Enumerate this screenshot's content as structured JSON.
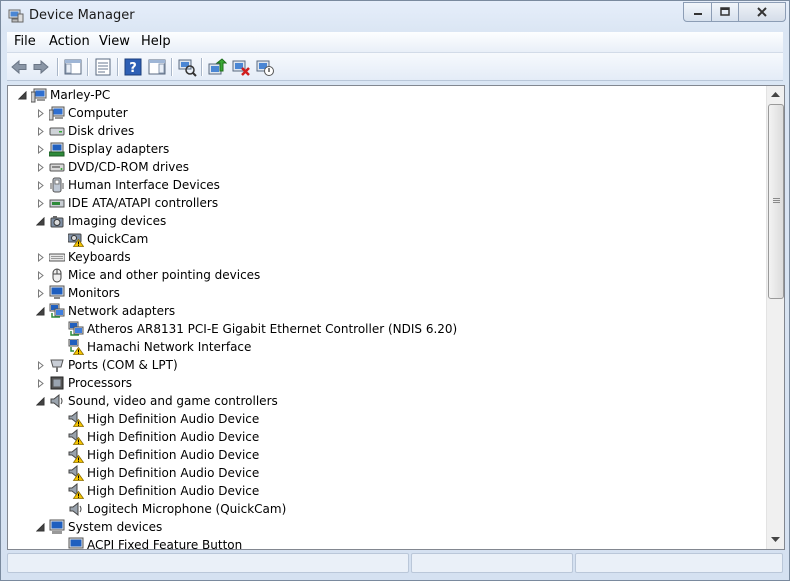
{
  "window": {
    "title": "Device Manager"
  },
  "menu": {
    "items": [
      "File",
      "Action",
      "View",
      "Help"
    ]
  },
  "toolbar": {
    "buttons": [
      "back",
      "forward",
      "show-hide-console-tree",
      "properties",
      "help",
      "show-action-pane",
      "scan-hardware-changes",
      "update-driver",
      "uninstall",
      "enable-disable"
    ]
  },
  "tree": {
    "rows": [
      {
        "label": "Marley-PC",
        "level": 0,
        "expander": "expanded",
        "icon": "computer-icon"
      },
      {
        "label": "Computer",
        "level": 1,
        "expander": "collapsed",
        "icon": "computer-icon"
      },
      {
        "label": "Disk drives",
        "level": 1,
        "expander": "collapsed",
        "icon": "disk-drive-icon"
      },
      {
        "label": "Display adapters",
        "level": 1,
        "expander": "collapsed",
        "icon": "display-adapter-icon"
      },
      {
        "label": "DVD/CD-ROM drives",
        "level": 1,
        "expander": "collapsed",
        "icon": "dvd-drive-icon"
      },
      {
        "label": "Human Interface Devices",
        "level": 1,
        "expander": "collapsed",
        "icon": "hid-icon"
      },
      {
        "label": "IDE ATA/ATAPI controllers",
        "level": 1,
        "expander": "collapsed",
        "icon": "ide-controller-icon"
      },
      {
        "label": "Imaging devices",
        "level": 1,
        "expander": "expanded",
        "icon": "camera-icon"
      },
      {
        "label": "QuickCam",
        "level": 2,
        "expander": "none",
        "icon": "camera-warning-icon"
      },
      {
        "label": "Keyboards",
        "level": 1,
        "expander": "collapsed",
        "icon": "keyboard-icon"
      },
      {
        "label": "Mice and other pointing devices",
        "level": 1,
        "expander": "collapsed",
        "icon": "mouse-icon"
      },
      {
        "label": "Monitors",
        "level": 1,
        "expander": "collapsed",
        "icon": "monitor-icon"
      },
      {
        "label": "Network adapters",
        "level": 1,
        "expander": "expanded",
        "icon": "network-icon"
      },
      {
        "label": "Atheros AR8131 PCI-E Gigabit Ethernet Controller (NDIS 6.20)",
        "level": 2,
        "expander": "none",
        "icon": "network-icon"
      },
      {
        "label": "Hamachi Network Interface",
        "level": 2,
        "expander": "none",
        "icon": "network-warning-icon"
      },
      {
        "label": "Ports (COM & LPT)",
        "level": 1,
        "expander": "collapsed",
        "icon": "port-icon"
      },
      {
        "label": "Processors",
        "level": 1,
        "expander": "collapsed",
        "icon": "processor-icon"
      },
      {
        "label": "Sound, video and game controllers",
        "level": 1,
        "expander": "expanded",
        "icon": "speaker-icon"
      },
      {
        "label": "High Definition Audio Device",
        "level": 2,
        "expander": "none",
        "icon": "speaker-warning-icon"
      },
      {
        "label": "High Definition Audio Device",
        "level": 2,
        "expander": "none",
        "icon": "speaker-warning-icon"
      },
      {
        "label": "High Definition Audio Device",
        "level": 2,
        "expander": "none",
        "icon": "speaker-warning-icon"
      },
      {
        "label": "High Definition Audio Device",
        "level": 2,
        "expander": "none",
        "icon": "speaker-warning-icon"
      },
      {
        "label": "High Definition Audio Device",
        "level": 2,
        "expander": "none",
        "icon": "speaker-warning-icon"
      },
      {
        "label": "Logitech Microphone (QuickCam)",
        "level": 2,
        "expander": "none",
        "icon": "speaker-icon"
      },
      {
        "label": "System devices",
        "level": 1,
        "expander": "expanded",
        "icon": "system-devices-icon"
      },
      {
        "label": "ACPI Fixed Feature Button",
        "level": 2,
        "expander": "none",
        "icon": "system-devices-icon"
      }
    ]
  },
  "colors": {
    "titlebar": "#dbe6f4",
    "warning": "#f5c400",
    "monitor_blue": "#1f5fbf"
  }
}
